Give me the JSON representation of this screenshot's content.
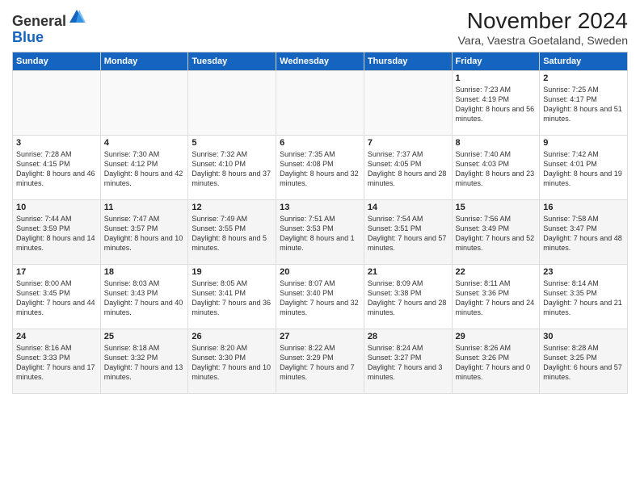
{
  "logo": {
    "line1": "General",
    "line2": "Blue"
  },
  "title": "November 2024",
  "subtitle": "Vara, Vaestra Goetaland, Sweden",
  "headers": [
    "Sunday",
    "Monday",
    "Tuesday",
    "Wednesday",
    "Thursday",
    "Friday",
    "Saturday"
  ],
  "weeks": [
    [
      {
        "day": "",
        "info": ""
      },
      {
        "day": "",
        "info": ""
      },
      {
        "day": "",
        "info": ""
      },
      {
        "day": "",
        "info": ""
      },
      {
        "day": "",
        "info": ""
      },
      {
        "day": "1",
        "info": "Sunrise: 7:23 AM\nSunset: 4:19 PM\nDaylight: 8 hours\nand 56 minutes."
      },
      {
        "day": "2",
        "info": "Sunrise: 7:25 AM\nSunset: 4:17 PM\nDaylight: 8 hours\nand 51 minutes."
      }
    ],
    [
      {
        "day": "3",
        "info": "Sunrise: 7:28 AM\nSunset: 4:15 PM\nDaylight: 8 hours\nand 46 minutes."
      },
      {
        "day": "4",
        "info": "Sunrise: 7:30 AM\nSunset: 4:12 PM\nDaylight: 8 hours\nand 42 minutes."
      },
      {
        "day": "5",
        "info": "Sunrise: 7:32 AM\nSunset: 4:10 PM\nDaylight: 8 hours\nand 37 minutes."
      },
      {
        "day": "6",
        "info": "Sunrise: 7:35 AM\nSunset: 4:08 PM\nDaylight: 8 hours\nand 32 minutes."
      },
      {
        "day": "7",
        "info": "Sunrise: 7:37 AM\nSunset: 4:05 PM\nDaylight: 8 hours\nand 28 minutes."
      },
      {
        "day": "8",
        "info": "Sunrise: 7:40 AM\nSunset: 4:03 PM\nDaylight: 8 hours\nand 23 minutes."
      },
      {
        "day": "9",
        "info": "Sunrise: 7:42 AM\nSunset: 4:01 PM\nDaylight: 8 hours\nand 19 minutes."
      }
    ],
    [
      {
        "day": "10",
        "info": "Sunrise: 7:44 AM\nSunset: 3:59 PM\nDaylight: 8 hours\nand 14 minutes."
      },
      {
        "day": "11",
        "info": "Sunrise: 7:47 AM\nSunset: 3:57 PM\nDaylight: 8 hours\nand 10 minutes."
      },
      {
        "day": "12",
        "info": "Sunrise: 7:49 AM\nSunset: 3:55 PM\nDaylight: 8 hours\nand 5 minutes."
      },
      {
        "day": "13",
        "info": "Sunrise: 7:51 AM\nSunset: 3:53 PM\nDaylight: 8 hours\nand 1 minute."
      },
      {
        "day": "14",
        "info": "Sunrise: 7:54 AM\nSunset: 3:51 PM\nDaylight: 7 hours\nand 57 minutes."
      },
      {
        "day": "15",
        "info": "Sunrise: 7:56 AM\nSunset: 3:49 PM\nDaylight: 7 hours\nand 52 minutes."
      },
      {
        "day": "16",
        "info": "Sunrise: 7:58 AM\nSunset: 3:47 PM\nDaylight: 7 hours\nand 48 minutes."
      }
    ],
    [
      {
        "day": "17",
        "info": "Sunrise: 8:00 AM\nSunset: 3:45 PM\nDaylight: 7 hours\nand 44 minutes."
      },
      {
        "day": "18",
        "info": "Sunrise: 8:03 AM\nSunset: 3:43 PM\nDaylight: 7 hours\nand 40 minutes."
      },
      {
        "day": "19",
        "info": "Sunrise: 8:05 AM\nSunset: 3:41 PM\nDaylight: 7 hours\nand 36 minutes."
      },
      {
        "day": "20",
        "info": "Sunrise: 8:07 AM\nSunset: 3:40 PM\nDaylight: 7 hours\nand 32 minutes."
      },
      {
        "day": "21",
        "info": "Sunrise: 8:09 AM\nSunset: 3:38 PM\nDaylight: 7 hours\nand 28 minutes."
      },
      {
        "day": "22",
        "info": "Sunrise: 8:11 AM\nSunset: 3:36 PM\nDaylight: 7 hours\nand 24 minutes."
      },
      {
        "day": "23",
        "info": "Sunrise: 8:14 AM\nSunset: 3:35 PM\nDaylight: 7 hours\nand 21 minutes."
      }
    ],
    [
      {
        "day": "24",
        "info": "Sunrise: 8:16 AM\nSunset: 3:33 PM\nDaylight: 7 hours\nand 17 minutes."
      },
      {
        "day": "25",
        "info": "Sunrise: 8:18 AM\nSunset: 3:32 PM\nDaylight: 7 hours\nand 13 minutes."
      },
      {
        "day": "26",
        "info": "Sunrise: 8:20 AM\nSunset: 3:30 PM\nDaylight: 7 hours\nand 10 minutes."
      },
      {
        "day": "27",
        "info": "Sunrise: 8:22 AM\nSunset: 3:29 PM\nDaylight: 7 hours\nand 7 minutes."
      },
      {
        "day": "28",
        "info": "Sunrise: 8:24 AM\nSunset: 3:27 PM\nDaylight: 7 hours\nand 3 minutes."
      },
      {
        "day": "29",
        "info": "Sunrise: 8:26 AM\nSunset: 3:26 PM\nDaylight: 7 hours\nand 0 minutes."
      },
      {
        "day": "30",
        "info": "Sunrise: 8:28 AM\nSunset: 3:25 PM\nDaylight: 6 hours\nand 57 minutes."
      }
    ]
  ]
}
